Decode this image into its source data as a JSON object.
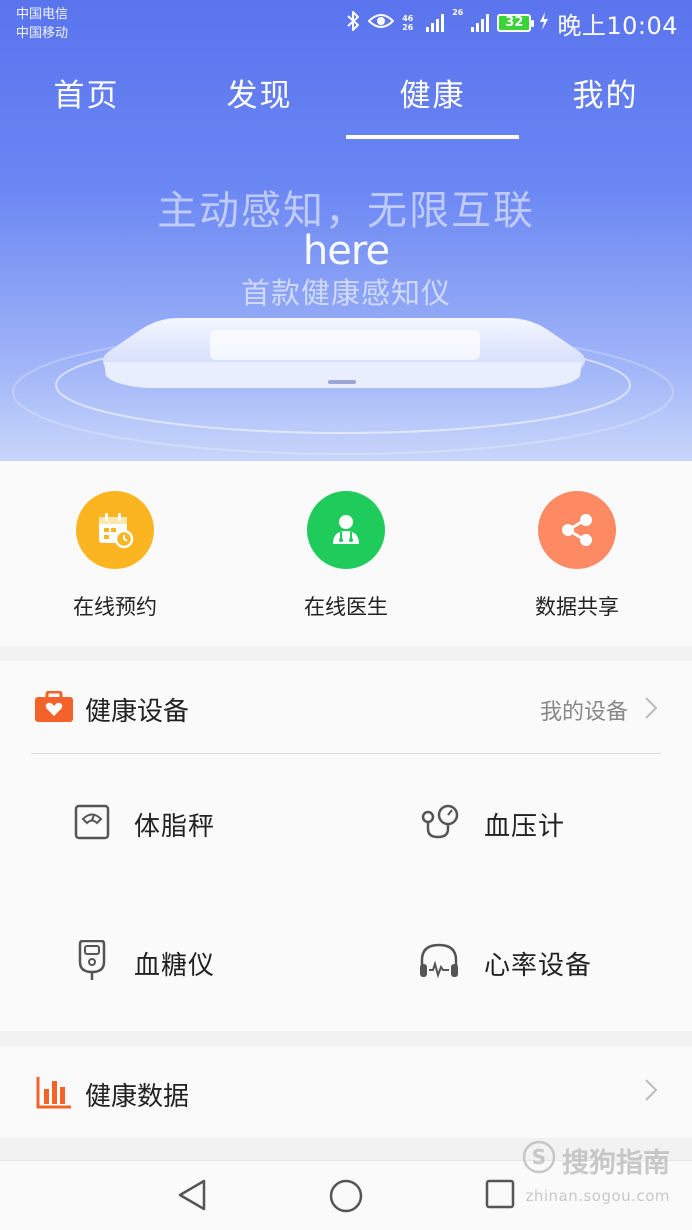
{
  "status_bar": {
    "carrier_1": "中国电信",
    "carrier_2": "中国移动",
    "network_1": "46 26",
    "network_2": "26",
    "battery": "32",
    "time": "晚上10:04"
  },
  "tabs": [
    {
      "label": "首页",
      "active": false
    },
    {
      "label": "发现",
      "active": false
    },
    {
      "label": "健康",
      "active": true
    },
    {
      "label": "我的",
      "active": false
    }
  ],
  "banner": {
    "title": "主动感知，无限互联",
    "brand": "here",
    "subtitle": "首款健康感知仪"
  },
  "shortcuts": [
    {
      "label": "在线预约",
      "icon": "calendar-clock-icon",
      "color": "#fbb521"
    },
    {
      "label": "在线医生",
      "icon": "doctor-icon",
      "color": "#1ecb5b"
    },
    {
      "label": "数据共享",
      "icon": "share-icon",
      "color": "#fd8a63"
    }
  ],
  "health_devices": {
    "title": "健康设备",
    "more_label": "我的设备",
    "icon": "medical-kit-icon",
    "accent": "#f4622b",
    "items": [
      {
        "label": "体脂秤",
        "icon": "scale-icon"
      },
      {
        "label": "血压计",
        "icon": "blood-pressure-icon"
      },
      {
        "label": "血糖仪",
        "icon": "glucose-meter-icon"
      },
      {
        "label": "心率设备",
        "icon": "headphone-heart-rate-icon"
      }
    ]
  },
  "health_data": {
    "title": "健康数据",
    "icon": "bar-chart-icon"
  },
  "watermark": {
    "main": "搜狗指南",
    "sub": "zhinan.sogou.com"
  }
}
